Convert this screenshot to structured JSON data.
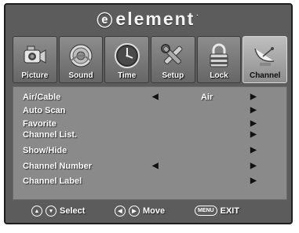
{
  "brand": {
    "name": "element",
    "logo": "element-logo-e",
    "tm": "."
  },
  "tabs": [
    {
      "label": "Picture",
      "icon": "camcorder-icon",
      "active": false
    },
    {
      "label": "Sound",
      "icon": "speaker-icon",
      "active": false
    },
    {
      "label": "Time",
      "icon": "clock-icon",
      "active": false
    },
    {
      "label": "Setup",
      "icon": "tools-icon",
      "active": false
    },
    {
      "label": "Lock",
      "icon": "padlock-icon",
      "active": false
    },
    {
      "label": "Channel",
      "icon": "satellite-dish-icon",
      "active": true
    }
  ],
  "menu": [
    {
      "label": "Air/Cable",
      "left_arrow": "◀",
      "value": "Air",
      "right_arrow": "▶"
    },
    {
      "label": "Auto Scan",
      "left_arrow": "",
      "value": "",
      "right_arrow": "▶"
    },
    {
      "label": "Favorite",
      "left_arrow": "",
      "value": "",
      "right_arrow": "▶"
    },
    {
      "label": "Channel List.",
      "left_arrow": "",
      "value": "",
      "right_arrow": "▶"
    },
    {
      "label": "Show/Hide",
      "left_arrow": "",
      "value": "",
      "right_arrow": "▶"
    },
    {
      "label": "Channel Number",
      "left_arrow": "◀",
      "value": "",
      "right_arrow": "▶"
    },
    {
      "label": "Channel Label",
      "left_arrow": "",
      "value": "",
      "right_arrow": "▶"
    }
  ],
  "footer": {
    "select": "Select",
    "move": "Move",
    "menu_key": "MENU",
    "exit": "EXIT",
    "up_glyph": "▲",
    "down_glyph": "▼",
    "left_glyph": "◀",
    "right_glyph": "▶"
  }
}
